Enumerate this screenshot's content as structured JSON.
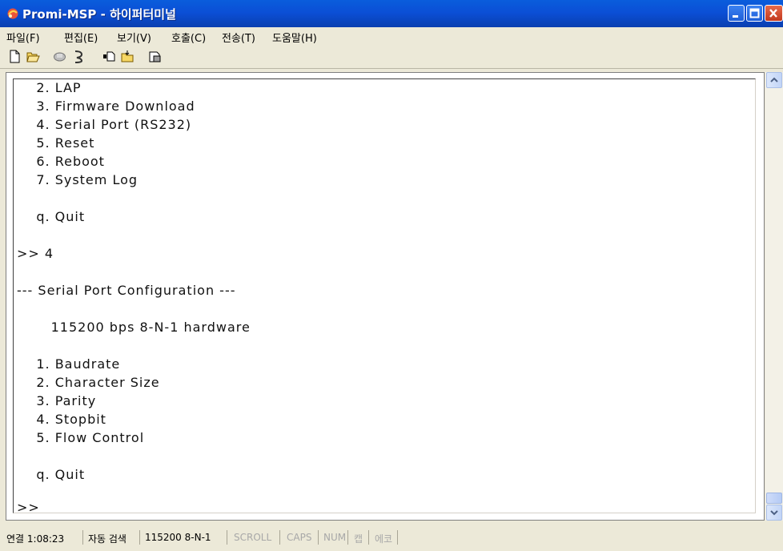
{
  "window": {
    "title": "Promi-MSP - 하이퍼터미널"
  },
  "menu": [
    "파일(F)",
    "편집(E)",
    "보기(V)",
    "호출(C)",
    "전송(T)",
    "도움말(H)"
  ],
  "toolbar_icons": [
    "new-connection-icon",
    "open-icon",
    "disconnect-icon",
    "dial-icon",
    "send-icon",
    "receive-icon",
    "properties-icon"
  ],
  "terminal": {
    "lines": [
      "    2. LAP",
      "    3. Firmware Download",
      "    4. Serial Port (RS232)",
      "    5. Reset",
      "    6. Reboot",
      "    7. System Log",
      "",
      "    q. Quit",
      "",
      ">> 4",
      "",
      "--- Serial Port Configuration ---",
      "",
      "       115200 bps 8-N-1 hardware",
      "",
      "    1. Baudrate",
      "    2. Character Size",
      "    3. Parity",
      "    4. Stopbit",
      "    5. Flow Control",
      "",
      "    q. Quit",
      "",
      ">>"
    ]
  },
  "status": {
    "connection": "연결 1:08:23",
    "detect": "자동 검색",
    "settings": "115200 8-N-1",
    "scroll": "SCROLL",
    "caps": "CAPS",
    "num": "NUM",
    "capture": "캡",
    "echo": "에코"
  }
}
